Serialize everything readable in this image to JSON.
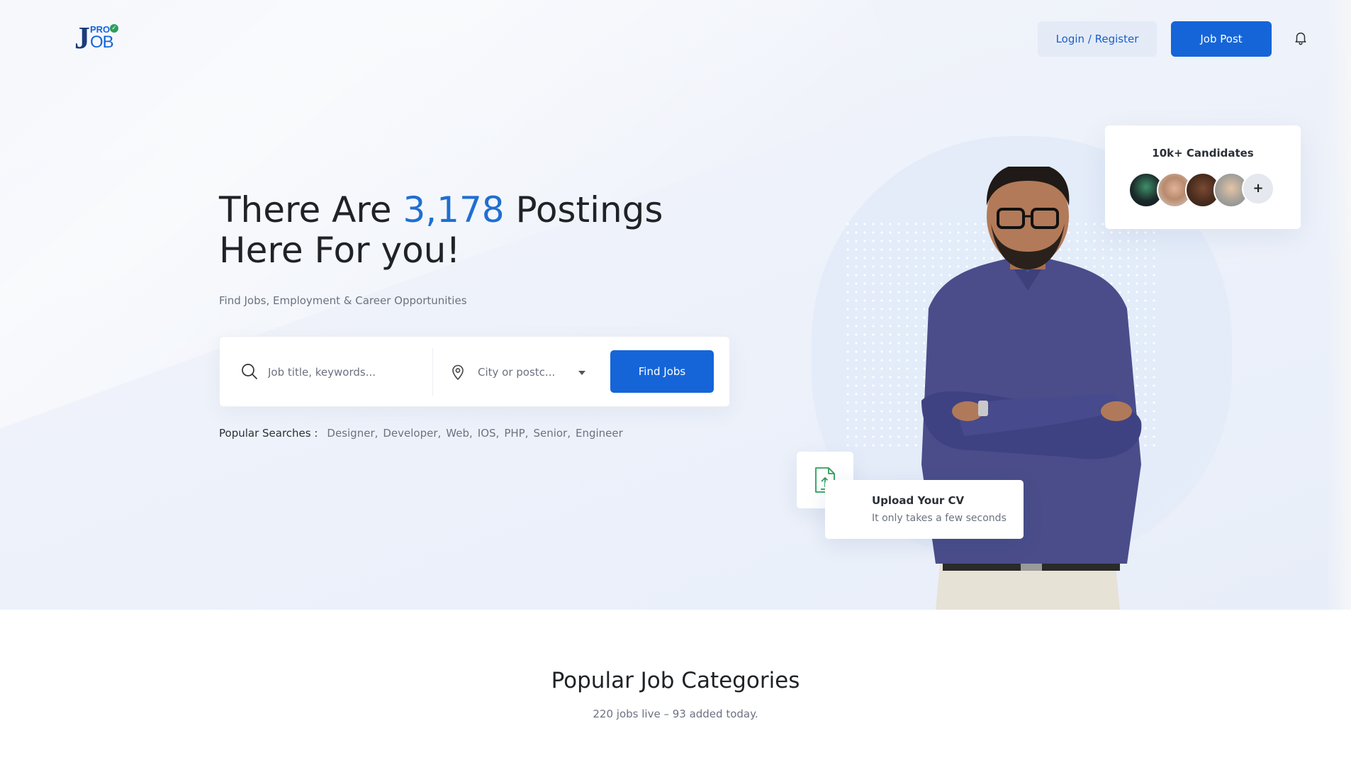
{
  "header": {
    "logo_text": {
      "letter": "J",
      "top": "PRO",
      "bottom": "OB"
    },
    "login_label": "Login / Register",
    "post_label": "Job Post",
    "notification_icon": "bell-icon"
  },
  "hero": {
    "headline_before": "There Are ",
    "headline_count": "3,178",
    "headline_after": " Postings Here For you!",
    "subtitle": "Find Jobs, Employment & Career Opportunities",
    "search": {
      "keyword_placeholder": "Job title, keywords...",
      "location_selected": "City or postc...",
      "submit_label": "Find Jobs"
    },
    "popular": {
      "label": "Popular Searches :",
      "tags": [
        "Designer,",
        "Developer,",
        "Web,",
        "IOS,",
        "PHP,",
        "Senior,",
        "Engineer"
      ]
    },
    "candidates": {
      "title": "10k+ Candidates",
      "more_symbol": "+"
    },
    "upload": {
      "title": "Upload Your CV",
      "subtitle": "It only takes a few seconds"
    }
  },
  "categories": {
    "title": "Popular Job Categories",
    "subtitle": "220 jobs live – 93 added today."
  },
  "colors": {
    "primary": "#1565d8",
    "accent_count": "#1f6fd1",
    "login_bg": "#e4ebf7",
    "upload_icon": "#2e9e5b"
  }
}
